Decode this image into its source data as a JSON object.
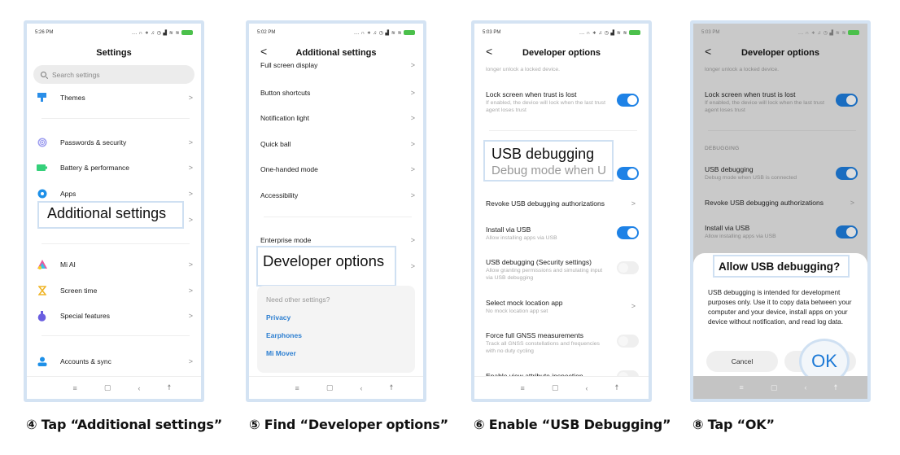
{
  "colors": {
    "accent": "#1e82e6",
    "link": "#2d7fd1",
    "callout_border": "#cfe0f2",
    "frame": "#d4e3f3"
  },
  "screens": [
    {
      "status_time": "5:26 PM",
      "status_icons": "... ∩ ∗ ♫ ◷ ▟ ≋ ≋",
      "title": "Settings",
      "search_placeholder": "Search settings",
      "items": [
        {
          "label": "Themes",
          "icon": "themes-icon"
        },
        {
          "label": "Passwords & security",
          "icon": "fingerprint-icon"
        },
        {
          "label": "Battery & performance",
          "icon": "battery-icon"
        },
        {
          "label": "Apps",
          "icon": "gear-icon"
        },
        {
          "label": "Additional settings",
          "icon": ""
        },
        {
          "label": "Mi AI",
          "icon": "mi-ai-icon"
        },
        {
          "label": "Screen time",
          "icon": "hourglass-icon"
        },
        {
          "label": "Special features",
          "icon": "potion-icon"
        },
        {
          "label": "Accounts & sync",
          "icon": "account-icon"
        }
      ],
      "callout": "Additional settings",
      "chevron": ">"
    },
    {
      "status_time": "5:02 PM",
      "status_icons": "... ∩ ∗ ♫ ◷ ▟ ≋ ≋",
      "title": "Additional settings",
      "back": "<",
      "items": [
        "Full screen display",
        "Button shortcuts",
        "Notification light",
        "Quick ball",
        "One-handed mode",
        "Accessibility",
        "Enterprise mode"
      ],
      "callout": "Developer options",
      "other_settings": {
        "question": "Need other settings?",
        "links": [
          "Privacy",
          "Earphones",
          "Mi Mover"
        ]
      },
      "chevron": ">"
    },
    {
      "status_time": "5:03 PM",
      "status_icons": "... ∩ ∗ ♫ ◷ ▟ ≋ ≋",
      "title": "Developer options",
      "back": "<",
      "top_fragment": "longer unlock a locked device.",
      "items": [
        {
          "title": "Lock screen when trust is lost",
          "subtitle": "If enabled, the device will lock when the last trust agent loses trust",
          "toggle": true
        },
        {
          "title": "Revoke USB debugging authorizations",
          "subtitle": "",
          "chevron": true
        },
        {
          "title": "Install via USB",
          "subtitle": "Allow installing apps via USB",
          "toggle": true
        },
        {
          "title": "USB debugging (Security settings)",
          "subtitle": "Allow granting permissions and simulating input via USB debugging",
          "toggle": false
        },
        {
          "title": "Select mock location app",
          "subtitle": "No mock location app set",
          "chevron": true
        },
        {
          "title": "Force full GNSS measurements",
          "subtitle": "Track all GNSS constellations and frequencies with no duty cycling",
          "toggle": false
        },
        {
          "title": "Enable view attribute inspection",
          "subtitle": "",
          "toggle": false
        }
      ],
      "callout_title": "USB debugging",
      "callout_subtitle": "Debug mode when U",
      "usb_debugging_on": true
    },
    {
      "status_time": "5:03 PM",
      "status_icons": "... ∩ ∗ ♫ ◷ ▟ ≋ ≋",
      "title": "Developer options",
      "back": "<",
      "top_fragment": "longer unlock a locked device.",
      "lock_title": "Lock screen when trust is lost",
      "lock_subtitle": "If enabled, the device will lock when the last trust agent loses trust",
      "section": "DEBUGGING",
      "usb_title": "USB debugging",
      "usb_subtitle": "Debug mode when USB is connected",
      "revoke": "Revoke USB debugging authorizations",
      "install_title": "Install via USB",
      "install_subtitle": "Allow installing apps via USB",
      "dialog": {
        "title": "Allow USB debugging?",
        "body": "USB debugging is intended for development purposes only. Use it to copy data between your computer and your device, install apps on your device without notification, and read log data.",
        "cancel": "Cancel",
        "ok": "OK"
      }
    }
  ],
  "navbar": {
    "menu": "≡",
    "home": "▢",
    "back": "‹",
    "accessibility": "☨"
  },
  "captions": [
    "④ Tap  “Additional settings”",
    "⑤ Find “Developer options”",
    "⑥ Enable  “USB Debugging”",
    "⑧ Tap  “OK”"
  ]
}
